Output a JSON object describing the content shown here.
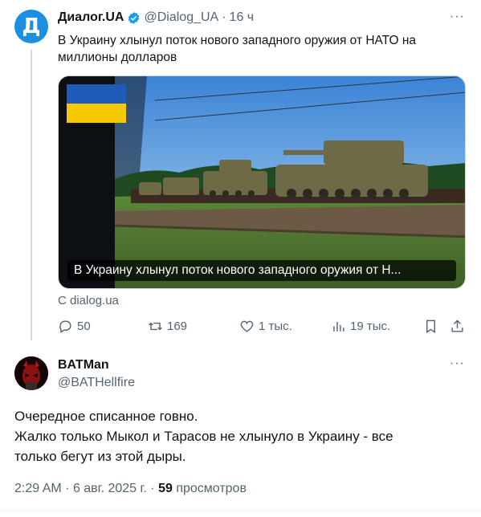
{
  "tweet": {
    "avatar_letter": "Д",
    "author_name": "Диалог.UA",
    "handle": "@Dialog_UA",
    "dot": "·",
    "time": "16 ч",
    "more": "···",
    "text": "В Украину хлынул поток нового западного оружия от НАТО на миллионы долларов",
    "media_caption": "В Украину хлынул поток нового западного оружия от Н...",
    "source": "С dialog.ua",
    "stats": {
      "replies": "50",
      "reposts": "169",
      "likes": "1 тыс.",
      "views": "19 тыс."
    }
  },
  "reply": {
    "author_name": "BATMan",
    "handle": "@BATHellfire",
    "more": "···",
    "text_line1": "Очередное списанное говно.",
    "text_line2": "Жалко только Мыкол и Тарасов не хлынуло в Украину - все",
    "text_line3": "только бегут из этой дыры.",
    "time": "2:29 AM",
    "date": "6 авг. 2025 г.",
    "sep": "·",
    "views_count": "59",
    "views_label": "просмотров"
  },
  "colors": {
    "accent": "#1d9bf0",
    "muted": "#536471",
    "flag_blue": "#1f5bb8",
    "flag_yellow": "#f5c800"
  }
}
